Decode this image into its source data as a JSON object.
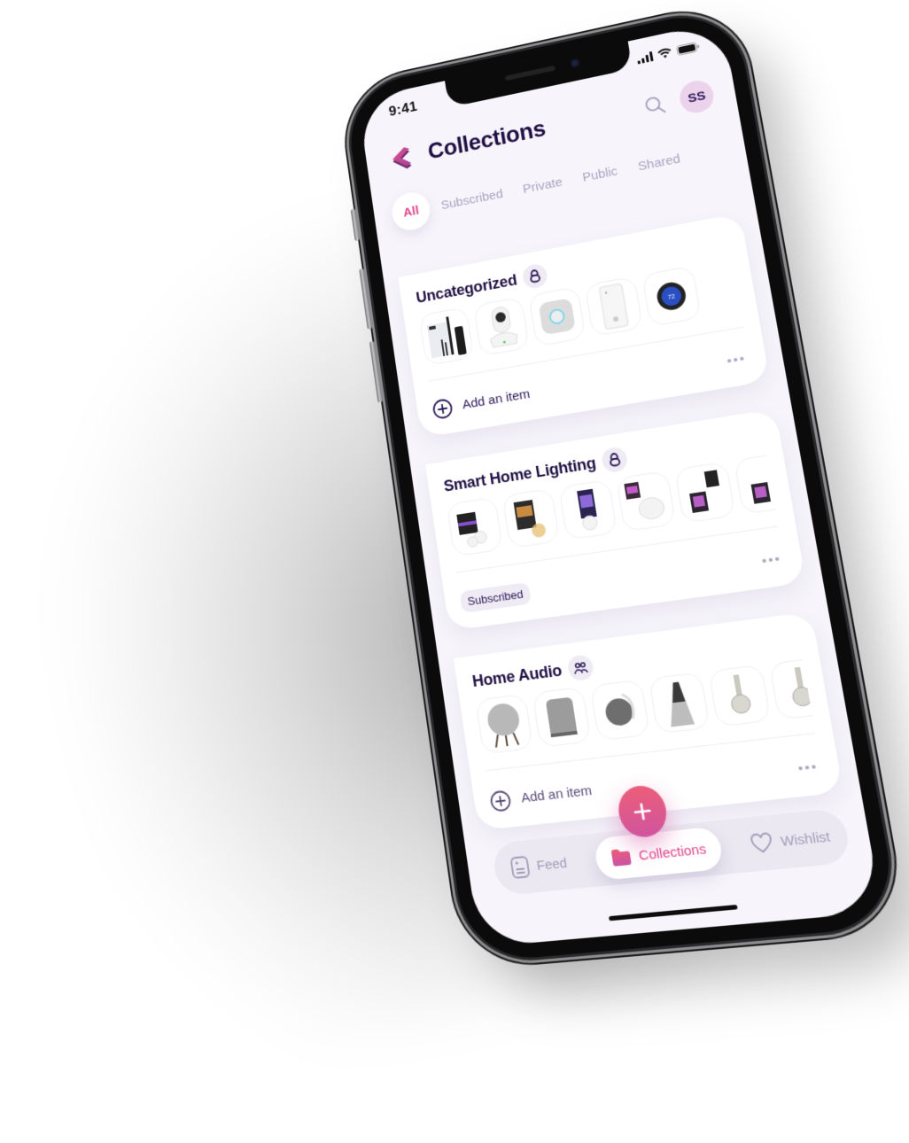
{
  "status_bar": {
    "time": "9:41"
  },
  "header": {
    "title": "Collections",
    "search_icon": "search-icon",
    "avatar_initials": "SS"
  },
  "filters": {
    "tabs": [
      {
        "label": "All",
        "active": true
      },
      {
        "label": "Subscribed",
        "active": false
      },
      {
        "label": "Private",
        "active": false
      },
      {
        "label": "Public",
        "active": false
      },
      {
        "label": "Shared",
        "active": false
      }
    ]
  },
  "collections": [
    {
      "title": "Uncategorized",
      "visibility_icon": "lock-icon",
      "items": [
        "toothbrush-set",
        "security-camera",
        "smoke-detector",
        "humidifier",
        "thermostat"
      ],
      "footer_action": "Add an item"
    },
    {
      "title": "Smart Home Lighting",
      "visibility_icon": "lock-icon",
      "items": [
        "bulb-starter-kit",
        "filament-bulb",
        "color-bulb",
        "go-lamp",
        "outdoor-lantern",
        "outdoor-lantern-2"
      ],
      "footer_badge": "Subscribed"
    },
    {
      "title": "Home Audio",
      "visibility_icon": "shared-users-icon",
      "items": [
        "round-speaker",
        "cylinder-speaker",
        "portable-speaker",
        "cone-speaker",
        "headphones",
        "headphones-2"
      ],
      "footer_action": "Add an item"
    }
  ],
  "fab": {
    "icon": "plus-icon"
  },
  "tab_bar": {
    "items": [
      {
        "label": "Feed",
        "icon": "feed-icon",
        "active": false
      },
      {
        "label": "Collections",
        "icon": "folder-icon",
        "active": true
      },
      {
        "label": "Wishlist",
        "icon": "heart-icon",
        "active": false
      }
    ]
  },
  "colors": {
    "accent": "#e0458b",
    "title": "#1e0e42",
    "muted": "#a9a2c0",
    "avatar_bg": "#ecd3ec",
    "screen_bg": "#f7f5fb",
    "fab_top": "#ec5d78",
    "fab_bottom": "#d0549f"
  }
}
